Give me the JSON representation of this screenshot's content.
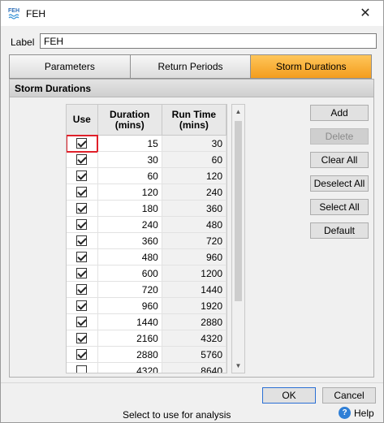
{
  "window": {
    "title": "FEH",
    "icon_text": "FEH"
  },
  "label": {
    "text": "Label",
    "value": "FEH"
  },
  "tabs": [
    {
      "label": "Parameters",
      "active": false
    },
    {
      "label": "Return Periods",
      "active": false
    },
    {
      "label": "Storm Durations",
      "active": true
    }
  ],
  "section": {
    "title": "Storm Durations"
  },
  "grid": {
    "headers": {
      "use": "Use",
      "duration": "Duration\n(mins)",
      "runtime": "Run Time\n(mins)"
    },
    "rows": [
      {
        "use": true,
        "duration": "15",
        "runtime": "30"
      },
      {
        "use": true,
        "duration": "30",
        "runtime": "60"
      },
      {
        "use": true,
        "duration": "60",
        "runtime": "120"
      },
      {
        "use": true,
        "duration": "120",
        "runtime": "240"
      },
      {
        "use": true,
        "duration": "180",
        "runtime": "360"
      },
      {
        "use": true,
        "duration": "240",
        "runtime": "480"
      },
      {
        "use": true,
        "duration": "360",
        "runtime": "720"
      },
      {
        "use": true,
        "duration": "480",
        "runtime": "960"
      },
      {
        "use": true,
        "duration": "600",
        "runtime": "1200"
      },
      {
        "use": true,
        "duration": "720",
        "runtime": "1440"
      },
      {
        "use": true,
        "duration": "960",
        "runtime": "1920"
      },
      {
        "use": true,
        "duration": "1440",
        "runtime": "2880"
      },
      {
        "use": true,
        "duration": "2160",
        "runtime": "4320"
      },
      {
        "use": true,
        "duration": "2880",
        "runtime": "5760"
      },
      {
        "use": false,
        "duration": "4320",
        "runtime": "8640"
      }
    ]
  },
  "buttons": {
    "add": "Add",
    "delete": "Delete",
    "clear_all": "Clear All",
    "deselect_all": "Deselect All",
    "select_all": "Select All",
    "default": "Default"
  },
  "footer": {
    "ok": "OK",
    "cancel": "Cancel",
    "status": "Select to use for analysis",
    "help": "Help"
  },
  "colors": {
    "active_tab": "#f39d1e",
    "selection_box": "#e0202a",
    "help_icon": "#2f7fd6"
  }
}
